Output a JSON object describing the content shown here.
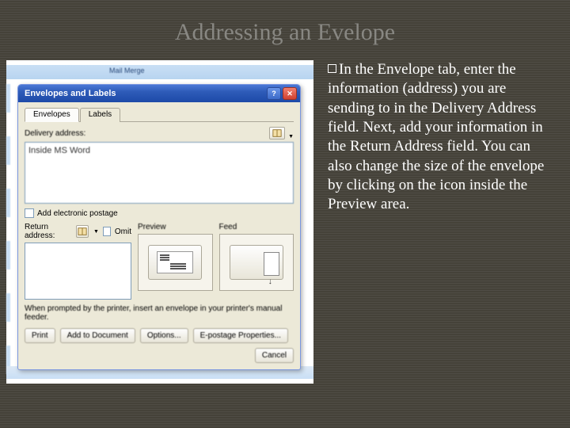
{
  "slide": {
    "title": "Addressing an Evelope"
  },
  "instruction": {
    "text": "In the Envelope tab, enter the information (address) you are sending to in the Delivery Address field. Next, add your information in the Return Address field. You can also change the size of the envelope by clicking on the icon inside the Preview area."
  },
  "dialog": {
    "title": "Envelopes and Labels",
    "tabs": {
      "envelopes": "Envelopes",
      "labels": "Labels"
    },
    "delivery_label": "Delivery address:",
    "delivery_value": "Inside MS Word",
    "add_postage_label": "Add electronic postage",
    "return_label": "Return address:",
    "omit_label": "Omit",
    "preview_label": "Preview",
    "feed_label": "Feed",
    "hint": "When prompted by the printer, insert an envelope in your printer's manual feeder.",
    "buttons": {
      "print": "Print",
      "add_to_doc": "Add to Document",
      "options": "Options...",
      "epostage": "E-postage Properties...",
      "cancel": "Cancel"
    }
  }
}
